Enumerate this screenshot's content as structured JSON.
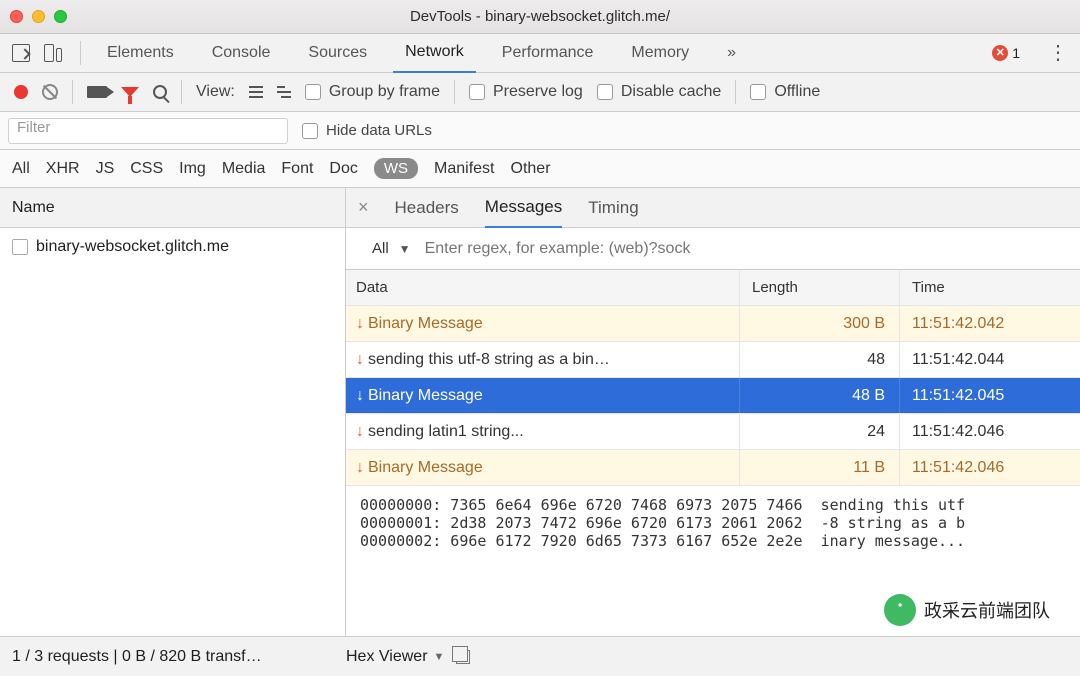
{
  "title": "DevTools - binary-websocket.glitch.me/",
  "tabs": [
    "Elements",
    "Console",
    "Sources",
    "Network",
    "Performance",
    "Memory"
  ],
  "activeTab": "Network",
  "errors": "1",
  "toolbar": {
    "view": "View:",
    "group": "Group by frame",
    "preserve": "Preserve log",
    "disable": "Disable cache",
    "offline": "Offline"
  },
  "filter": {
    "placeholder": "Filter",
    "hide": "Hide data URLs"
  },
  "types": [
    "All",
    "XHR",
    "JS",
    "CSS",
    "Img",
    "Media",
    "Font",
    "Doc",
    "WS",
    "Manifest",
    "Other"
  ],
  "selectedType": "WS",
  "nameHeader": "Name",
  "reqItem": "binary-websocket.glitch.me",
  "detailTabs": [
    "Headers",
    "Messages",
    "Timing"
  ],
  "activeDetail": "Messages",
  "msgFilter": {
    "all": "All",
    "placeholder": "Enter regex, for example: (web)?sock"
  },
  "colHeaders": {
    "data": "Data",
    "len": "Length",
    "time": "Time"
  },
  "rows": [
    {
      "dir": "↓",
      "text": "Binary Message",
      "len": "300 B",
      "time": "11:51:42.042",
      "kind": "binary"
    },
    {
      "dir": "↓",
      "text": "sending this utf-8 string as a bin…",
      "len": "48",
      "time": "11:51:42.044",
      "kind": "plain"
    },
    {
      "dir": "↓",
      "text": "Binary Message",
      "len": "48 B",
      "time": "11:51:42.045",
      "kind": "selected"
    },
    {
      "dir": "↓",
      "text": "sending latin1 string...",
      "len": "24",
      "time": "11:51:42.046",
      "kind": "plain"
    },
    {
      "dir": "↓",
      "text": "Binary Message",
      "len": "11 B",
      "time": "11:51:42.046",
      "kind": "binary"
    }
  ],
  "hex": "00000000: 7365 6e64 696e 6720 7468 6973 2075 7466  sending this utf\n00000001: 2d38 2073 7472 696e 6720 6173 2061 2062  -8 string as a b\n00000002: 696e 6172 7920 6d65 7373 6167 652e 2e2e  inary message...",
  "status": "1 / 3 requests | 0 B / 820 B transf…",
  "hexViewer": "Hex Viewer",
  "watermark": "政采云前端团队"
}
